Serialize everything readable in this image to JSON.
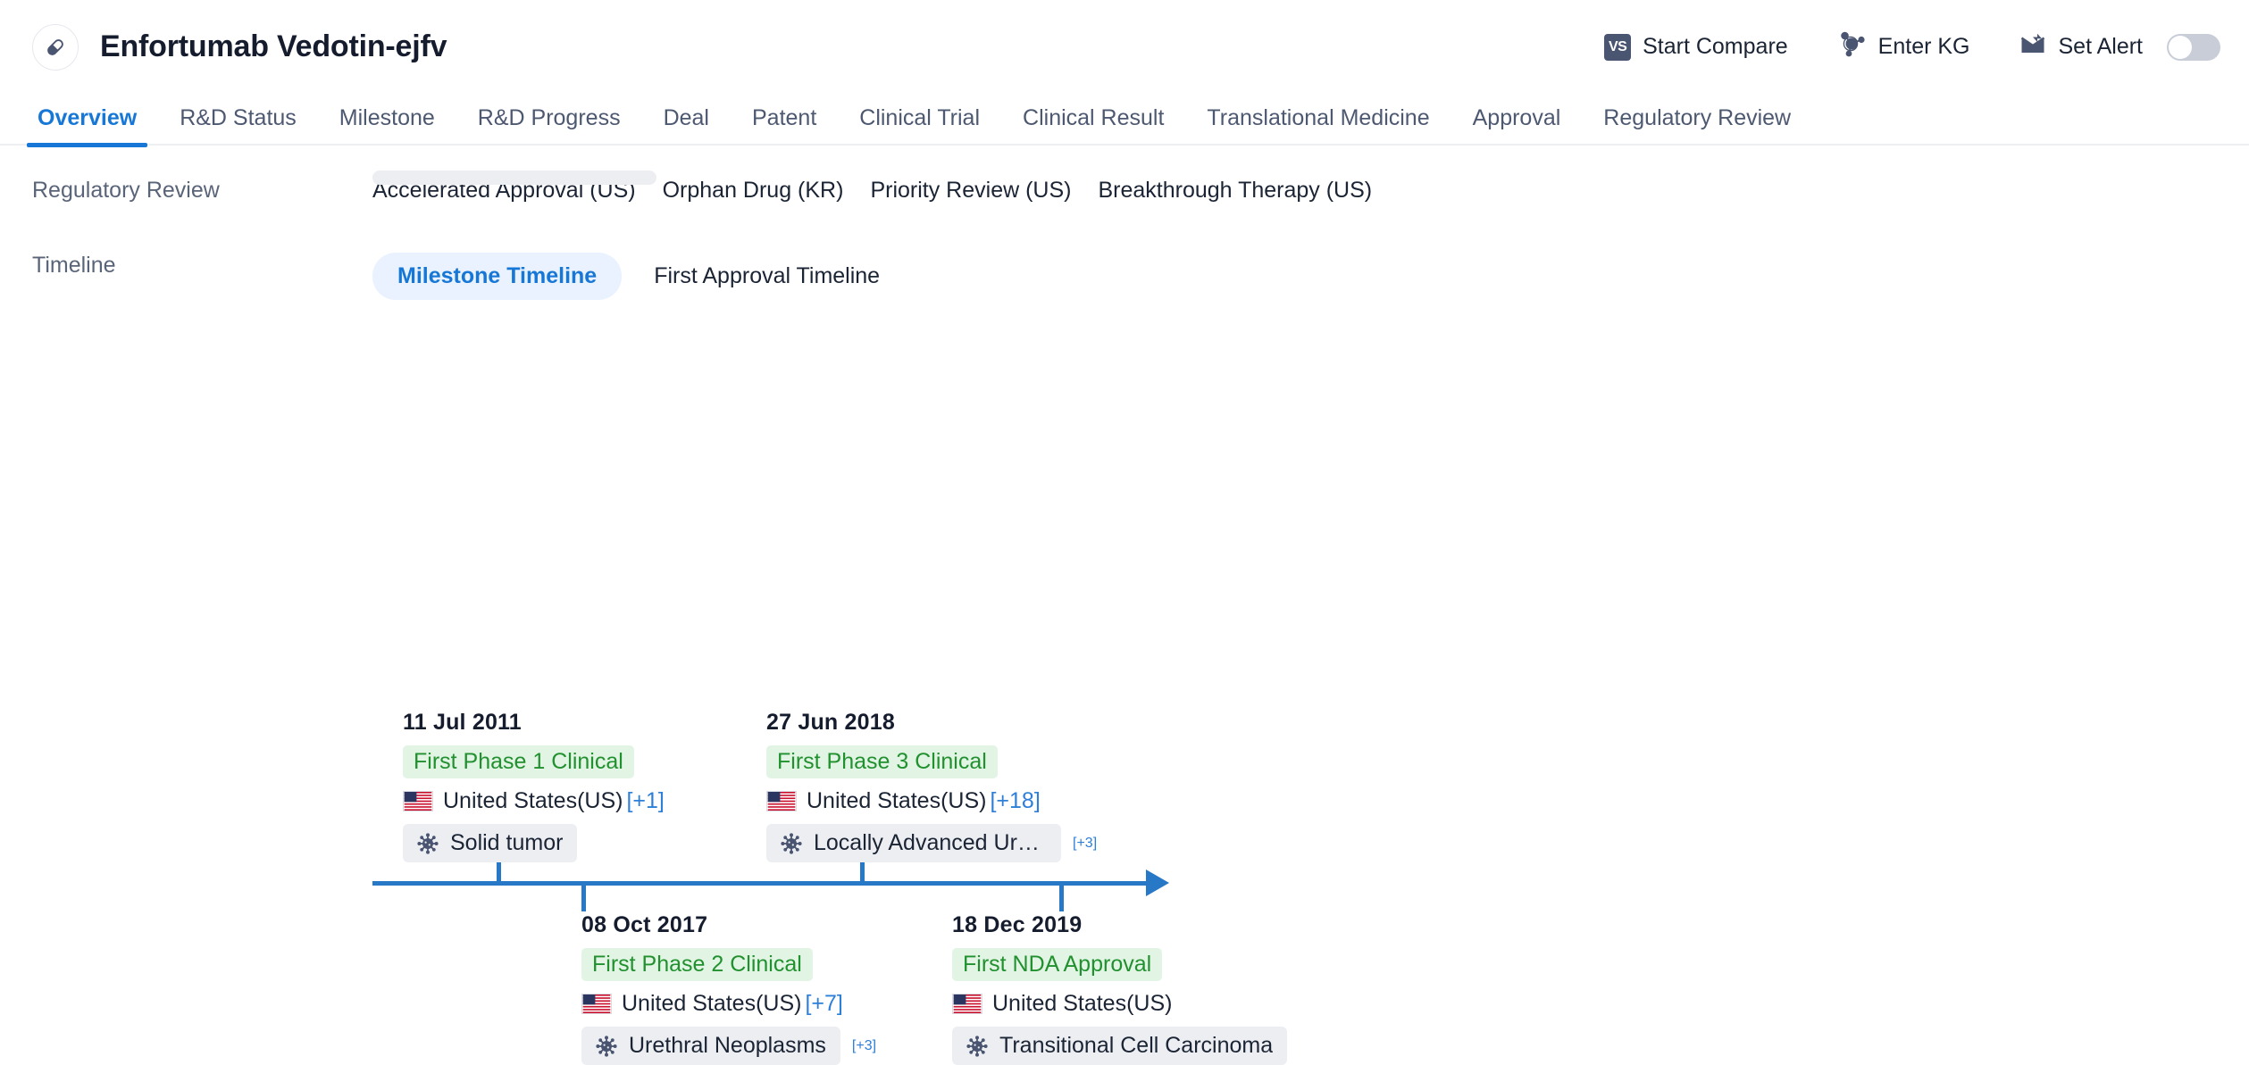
{
  "header": {
    "drug_icon": "capsule-icon",
    "title": "Enfortumab Vedotin-ejfv",
    "actions": [
      {
        "id": "start-compare",
        "icon": "vs-badge-icon",
        "badge_text": "VS",
        "label": "Start Compare"
      },
      {
        "id": "enter-kg",
        "icon": "knowledge-graph-icon",
        "label": "Enter KG"
      },
      {
        "id": "set-alert",
        "icon": "alert-envelope-icon",
        "label": "Set Alert",
        "toggle_on": false
      }
    ]
  },
  "tabs": [
    {
      "label": "Overview",
      "active": true
    },
    {
      "label": "R&D Status",
      "active": false
    },
    {
      "label": "Milestone",
      "active": false
    },
    {
      "label": "R&D Progress",
      "active": false
    },
    {
      "label": "Deal",
      "active": false
    },
    {
      "label": "Patent",
      "active": false
    },
    {
      "label": "Clinical Trial",
      "active": false
    },
    {
      "label": "Clinical Result",
      "active": false
    },
    {
      "label": "Translational Medicine",
      "active": false
    },
    {
      "label": "Approval",
      "active": false
    },
    {
      "label": "Regulatory Review",
      "active": false
    }
  ],
  "regulatory_review": {
    "label": "Regulatory Review",
    "items": [
      "Accelerated Approval (US)",
      "Orphan Drug (KR)",
      "Priority Review (US)",
      "Breakthrough Therapy (US)"
    ]
  },
  "timeline": {
    "label": "Timeline",
    "switch": [
      {
        "label": "Milestone Timeline",
        "active": true
      },
      {
        "label": "First Approval Timeline",
        "active": false
      }
    ],
    "nodes": [
      {
        "date": "11 Jul 2011",
        "stage": "First Phase 1 Clinical",
        "country": "United States(US)",
        "country_more": "[+1]",
        "disease": "Solid tumor",
        "disease_more": "",
        "position": "above",
        "tick_x": 556
      },
      {
        "date": "08 Oct 2017",
        "stage": "First Phase 2 Clinical",
        "country": "United States(US)",
        "country_more": "[+7]",
        "disease": "Urethral Neoplasms",
        "disease_more": "[+3]",
        "position": "below",
        "tick_x": 651
      },
      {
        "date": "27 Jun 2018",
        "stage": "First Phase 3 Clinical",
        "country": "United States(US)",
        "country_more": "[+18]",
        "disease": "Locally Advanced Urothe...",
        "disease_more": "[+3]",
        "position": "above",
        "tick_x": 963
      },
      {
        "date": "18 Dec 2019",
        "stage": "First NDA Approval",
        "country": "United States(US)",
        "country_more": "",
        "disease": "Transitional Cell Carcinoma",
        "disease_more": "",
        "position": "below",
        "tick_x": 1186
      }
    ]
  },
  "colors": {
    "accent_blue": "#1677d6",
    "timeline_blue": "#2878c8",
    "badge_green_bg": "#e2f4e4",
    "badge_green_text": "#21912f",
    "chip_grey": "#eceef2",
    "label_grey": "#5a6479"
  }
}
